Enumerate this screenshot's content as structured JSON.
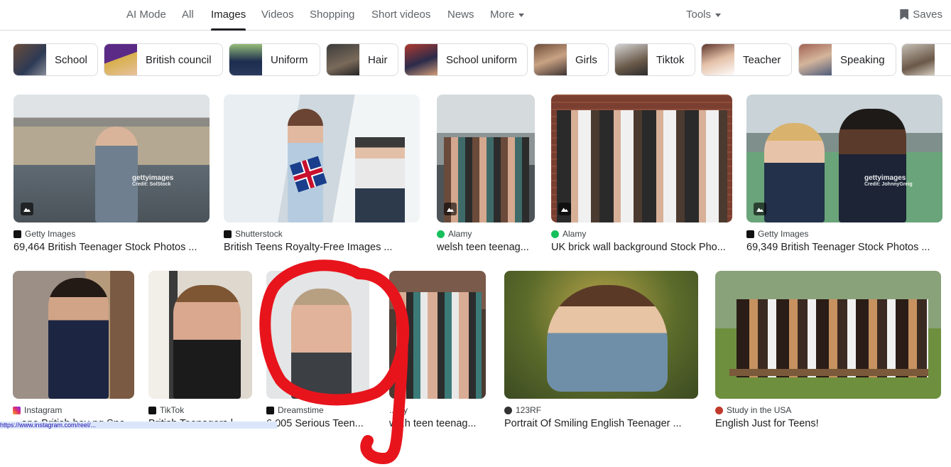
{
  "nav": {
    "tabs": [
      "AI Mode",
      "All",
      "Images",
      "Videos",
      "Shopping",
      "Short videos",
      "News",
      "More"
    ],
    "active_tab": "Images",
    "tools_label": "Tools",
    "saves_label": "Saves"
  },
  "chips": [
    "School",
    "British council",
    "Uniform",
    "Hair",
    "School uniform",
    "Girls",
    "Tiktok",
    "Teacher",
    "Speaking"
  ],
  "results_row1": [
    {
      "source": "Getty Images",
      "title": "69,464 British Teenager Stock Photos ...",
      "watermark": "gettyimages",
      "credit": "Credit: SolStock",
      "favicon_color": "#111111"
    },
    {
      "source": "Shutterstock",
      "title": "British Teens Royalty-Free Images ...",
      "favicon_color": "#111111"
    },
    {
      "source": "Alamy",
      "title": "welsh teen teenag...",
      "favicon_color": "#17c05c"
    },
    {
      "source": "Alamy",
      "title": "UK brick wall background Stock Pho...",
      "favicon_color": "#17c05c"
    },
    {
      "source": "Getty Images",
      "title": "69,349 British Teenager Stock Photos ...",
      "watermark": "gettyimages",
      "credit": "Credit: JohnnyGreig",
      "favicon_color": "#111111"
    }
  ],
  "results_row2": [
    {
      "source": "Instagram",
      "title": "...ape British boy ng Sno...",
      "favicon_color": "#e1306c"
    },
    {
      "source": "TikTok",
      "title": "British Teenagers l...",
      "favicon_color": "#111111"
    },
    {
      "source": "Dreamstime",
      "title": "6,005 Serious Teen...",
      "favicon_color": "#111111"
    },
    {
      "source": "...my",
      "title": "w...h teen teenag...",
      "favicon_color": "#17c05c"
    },
    {
      "source": "123RF",
      "title": "Portrait Of Smiling English Teenager ...",
      "favicon_color": "#333333"
    },
    {
      "source": "Study in the USA",
      "title": "English Just for Teens!",
      "favicon_color": "#c0392b"
    }
  ],
  "status_url": "https://www.instagram.com/reel/...",
  "colors": {
    "annotation": "#e8141c",
    "nav_text": "#5f6368",
    "active": "#202124",
    "border": "#dadce0"
  }
}
